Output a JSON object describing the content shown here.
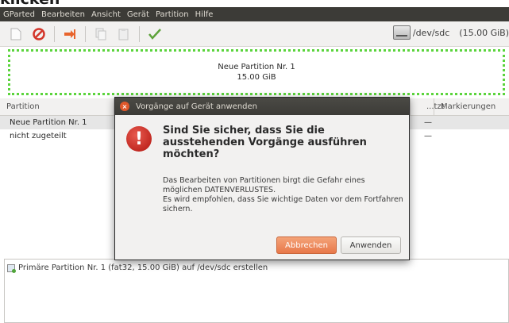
{
  "caption": "klicken",
  "menubar": {
    "items": [
      "GParted",
      "Bearbeiten",
      "Ansicht",
      "Gerät",
      "Partition",
      "Hilfe"
    ]
  },
  "toolbar": {
    "icons": [
      "new-icon",
      "delete-icon",
      "resize-icon",
      "copy-icon",
      "paste-icon",
      "apply-icon"
    ],
    "device_label": "/dev/sdc",
    "device_size": "(15.00 GiB)"
  },
  "partition_map": {
    "name": "Neue Partition Nr. 1",
    "size": "15.00 GiB"
  },
  "table": {
    "headers": [
      "Partition",
      "...tzt",
      "Markierungen"
    ],
    "rows": [
      {
        "partition": "Neue Partition Nr. 1",
        "used": "—"
      },
      {
        "partition": "nicht zugeteilt",
        "used": "—"
      }
    ]
  },
  "log": {
    "line": "Primäre Partition Nr. 1 (fat32, 15.00 GiB) auf /dev/sdc erstellen"
  },
  "dialog": {
    "title": "Vorgänge auf Gerät anwenden",
    "heading": "Sind Sie sicher, dass Sie die ausstehenden Vorgänge ausführen möchten?",
    "text_line1": "Das Bearbeiten von Partitionen birgt die Gefahr eines möglichen DATENVERLUSTES.",
    "text_line2": "Es wird empfohlen, dass Sie wichtige Daten vor dem Fortfahren sichern.",
    "cancel_label": "Abbrechen",
    "apply_label": "Anwenden"
  },
  "colors": {
    "menubar_bg": "#3c3b37",
    "accent_orange": "#e8784a",
    "partition_border": "#5bd43c",
    "alert_red": "#b2150f"
  }
}
